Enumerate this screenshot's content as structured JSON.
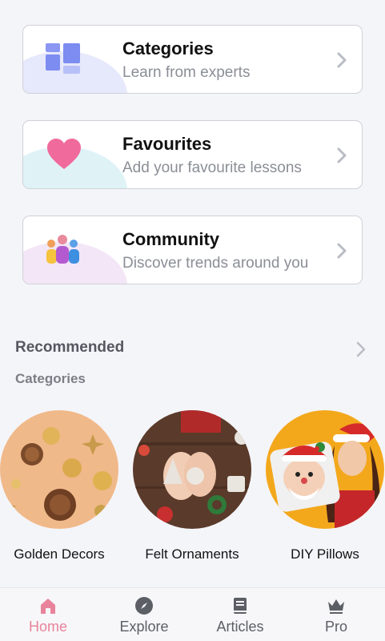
{
  "cards": [
    {
      "title": "Categories",
      "subtitle": "Learn from experts",
      "icon": "categories-grid-icon"
    },
    {
      "title": "Favourites",
      "subtitle": "Add your favourite lessons",
      "icon": "heart-icon"
    },
    {
      "title": "Community",
      "subtitle": "Discover trends around you",
      "icon": "people-icon"
    }
  ],
  "recommended": {
    "title": "Recommended",
    "subtitle": "Categories"
  },
  "categories": [
    {
      "label": "Golden Decors"
    },
    {
      "label": "Felt Ornaments"
    },
    {
      "label": "DIY Pillows"
    }
  ],
  "bottom_nav": [
    {
      "label": "Home",
      "icon": "home-icon",
      "active": true
    },
    {
      "label": "Explore",
      "icon": "compass-icon",
      "active": false
    },
    {
      "label": "Articles",
      "icon": "book-icon",
      "active": false
    },
    {
      "label": "Pro",
      "icon": "crown-icon",
      "active": false
    }
  ],
  "colors": {
    "accent": "#e8839b",
    "background": "#f4f5f9",
    "categories_icon": "#7d8cf0",
    "heart_icon": "#f06a9c"
  }
}
